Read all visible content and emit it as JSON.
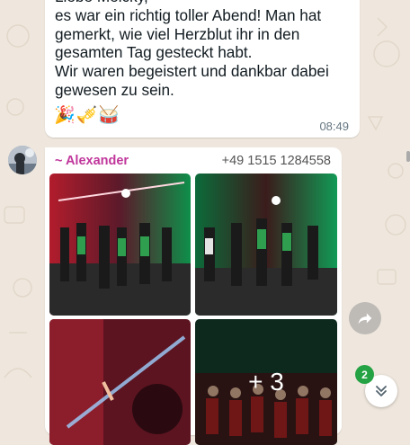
{
  "message1": {
    "text": "Liebe Meicky,\nes war ein richtig toller Abend! Man hat gemerkt, wie viel Herzblut ihr in den gesamten Tag gesteckt habt.\nWir waren begeistert und dankbar  dabei gewesen zu sein.",
    "emojis": "🎉🎺🥁",
    "time": "08:49"
  },
  "message2": {
    "sender": "~ Alexander",
    "phone": "+49 1515 1284558",
    "more_photos": "+ 3"
  },
  "unread_badge": "2",
  "icons": {
    "avatar": "avatar",
    "forward": "forward-icon",
    "scroll_down": "double-chevron-down-icon"
  },
  "colors": {
    "background": "#efe7dd",
    "sender": "#c0369b",
    "badge": "#25a244"
  }
}
